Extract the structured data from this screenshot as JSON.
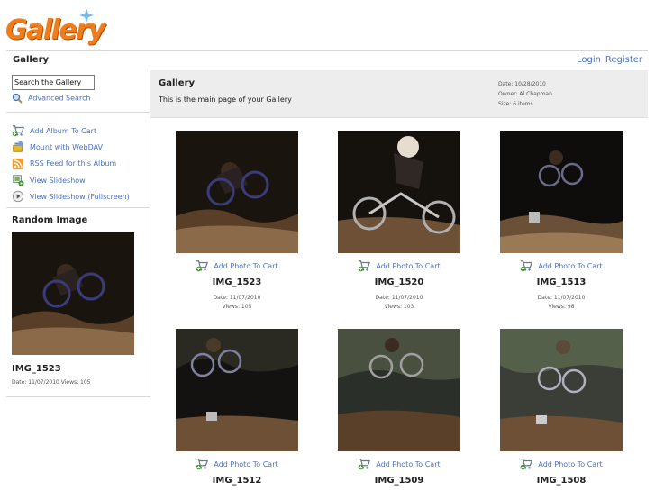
{
  "logo": {
    "text": "Gallery"
  },
  "topbar": {
    "title": "Gallery",
    "login": "Login",
    "register": "Register"
  },
  "sidebar": {
    "search_value": "Search the Gallery",
    "advanced_search": "Advanced Search",
    "actions": [
      {
        "label": "Add Album To Cart",
        "icon": "cart-add-icon"
      },
      {
        "label": "Mount with WebDAV",
        "icon": "webdav-icon"
      },
      {
        "label": "RSS Feed for this Album",
        "icon": "rss-icon"
      },
      {
        "label": "View Slideshow",
        "icon": "slideshow-icon"
      },
      {
        "label": "View Slideshow (Fullscreen)",
        "icon": "play-icon"
      }
    ],
    "random_heading": "Random Image",
    "random_name": "IMG_1523",
    "random_meta": "Date: 11/07/2010 Views: 105"
  },
  "album": {
    "title": "Gallery",
    "description": "This is the main page of your Gallery",
    "date": "Date: 10/28/2010",
    "owner": "Owner: Al Chapman",
    "size": "Size: 6 items"
  },
  "items": [
    {
      "name": "IMG_1523",
      "cart": "Add Photo To Cart",
      "date": "Date: 11/07/2010",
      "views": "Views: 105"
    },
    {
      "name": "IMG_1520",
      "cart": "Add Photo To Cart",
      "date": "Date: 11/07/2010",
      "views": "Views: 103"
    },
    {
      "name": "IMG_1513",
      "cart": "Add Photo To Cart",
      "date": "Date: 11/07/2010",
      "views": "Views: 98"
    },
    {
      "name": "IMG_1512",
      "cart": "Add Photo To Cart"
    },
    {
      "name": "IMG_1509",
      "cart": "Add Photo To Cart"
    },
    {
      "name": "IMG_1508",
      "cart": "Add Photo To Cart"
    }
  ],
  "colors": {
    "accent": "#f07d1a",
    "link": "#4a73c0",
    "header_bg": "#ededed"
  }
}
